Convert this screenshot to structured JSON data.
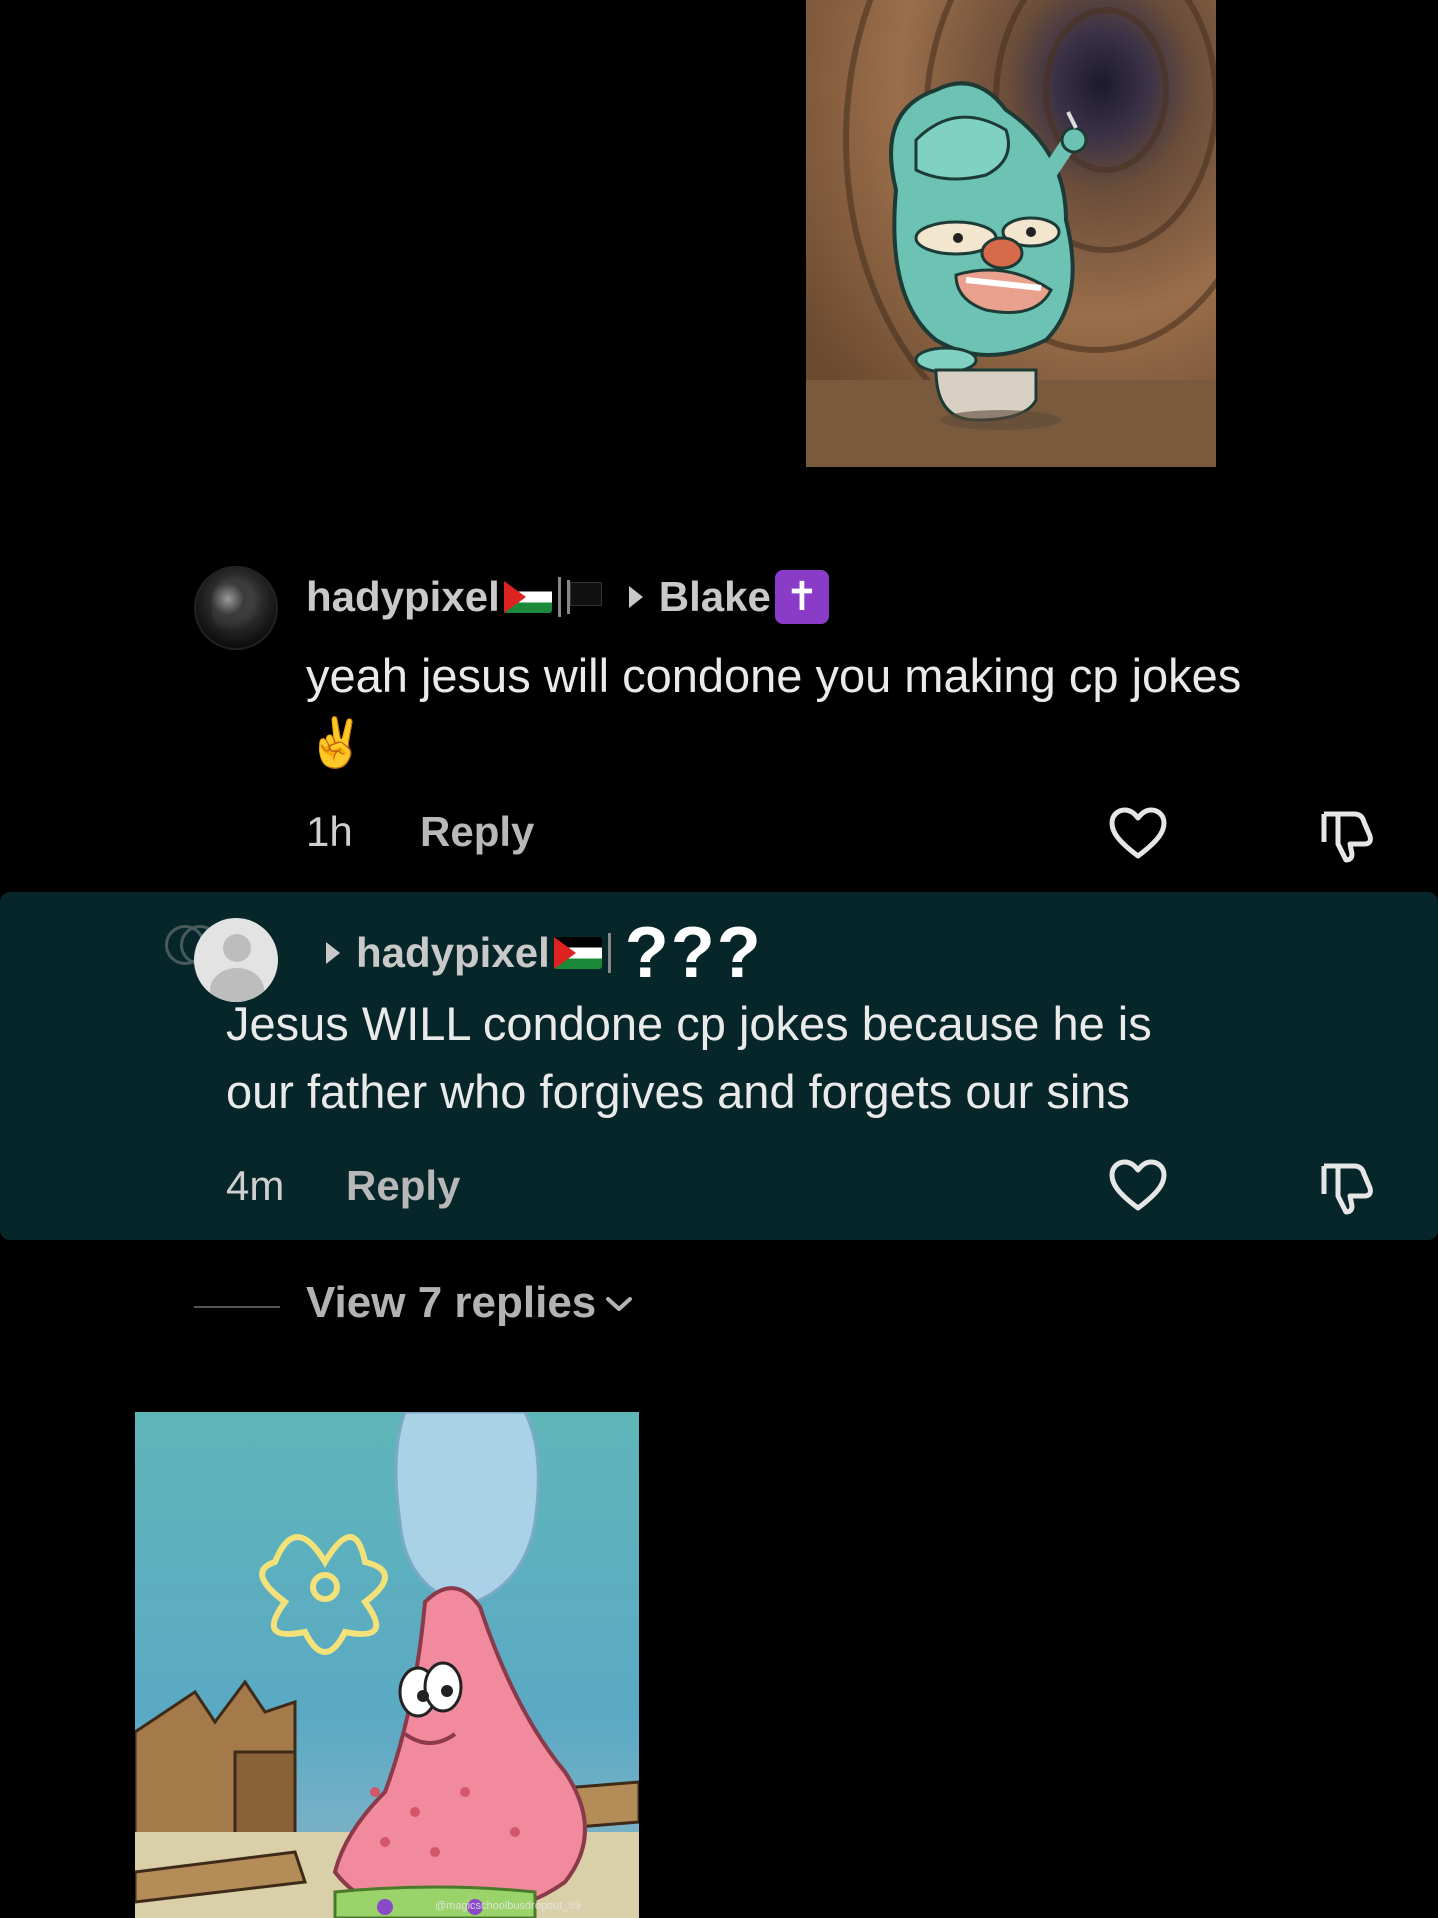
{
  "comment_1": {
    "username": "hadypixel",
    "reply_to": "Blake",
    "cross_symbol": "✝",
    "text": "yeah jesus will condone you making cp jokes",
    "emoji": "✌️",
    "time": "1h",
    "reply_label": "Reply"
  },
  "comment_2": {
    "reply_to": "hadypixel",
    "extra": "???",
    "text_line1": "Jesus WILL condone cp jokes because he is",
    "text_line2": "our father who forgives and forgets our sins",
    "time": "4m",
    "reply_label": "Reply"
  },
  "view_replies": "View 7 replies",
  "watermark": "@magicschoolbusdropout_69",
  "icons": {
    "like": "heart-outline-icon",
    "dislike": "thumbs-down-outline-icon",
    "expand": "chevron-down-icon",
    "play": "triangle-right-icon"
  },
  "colors": {
    "background": "#000000",
    "reply_highlight": "#06262a",
    "cross_badge": "#8a3cc8"
  }
}
